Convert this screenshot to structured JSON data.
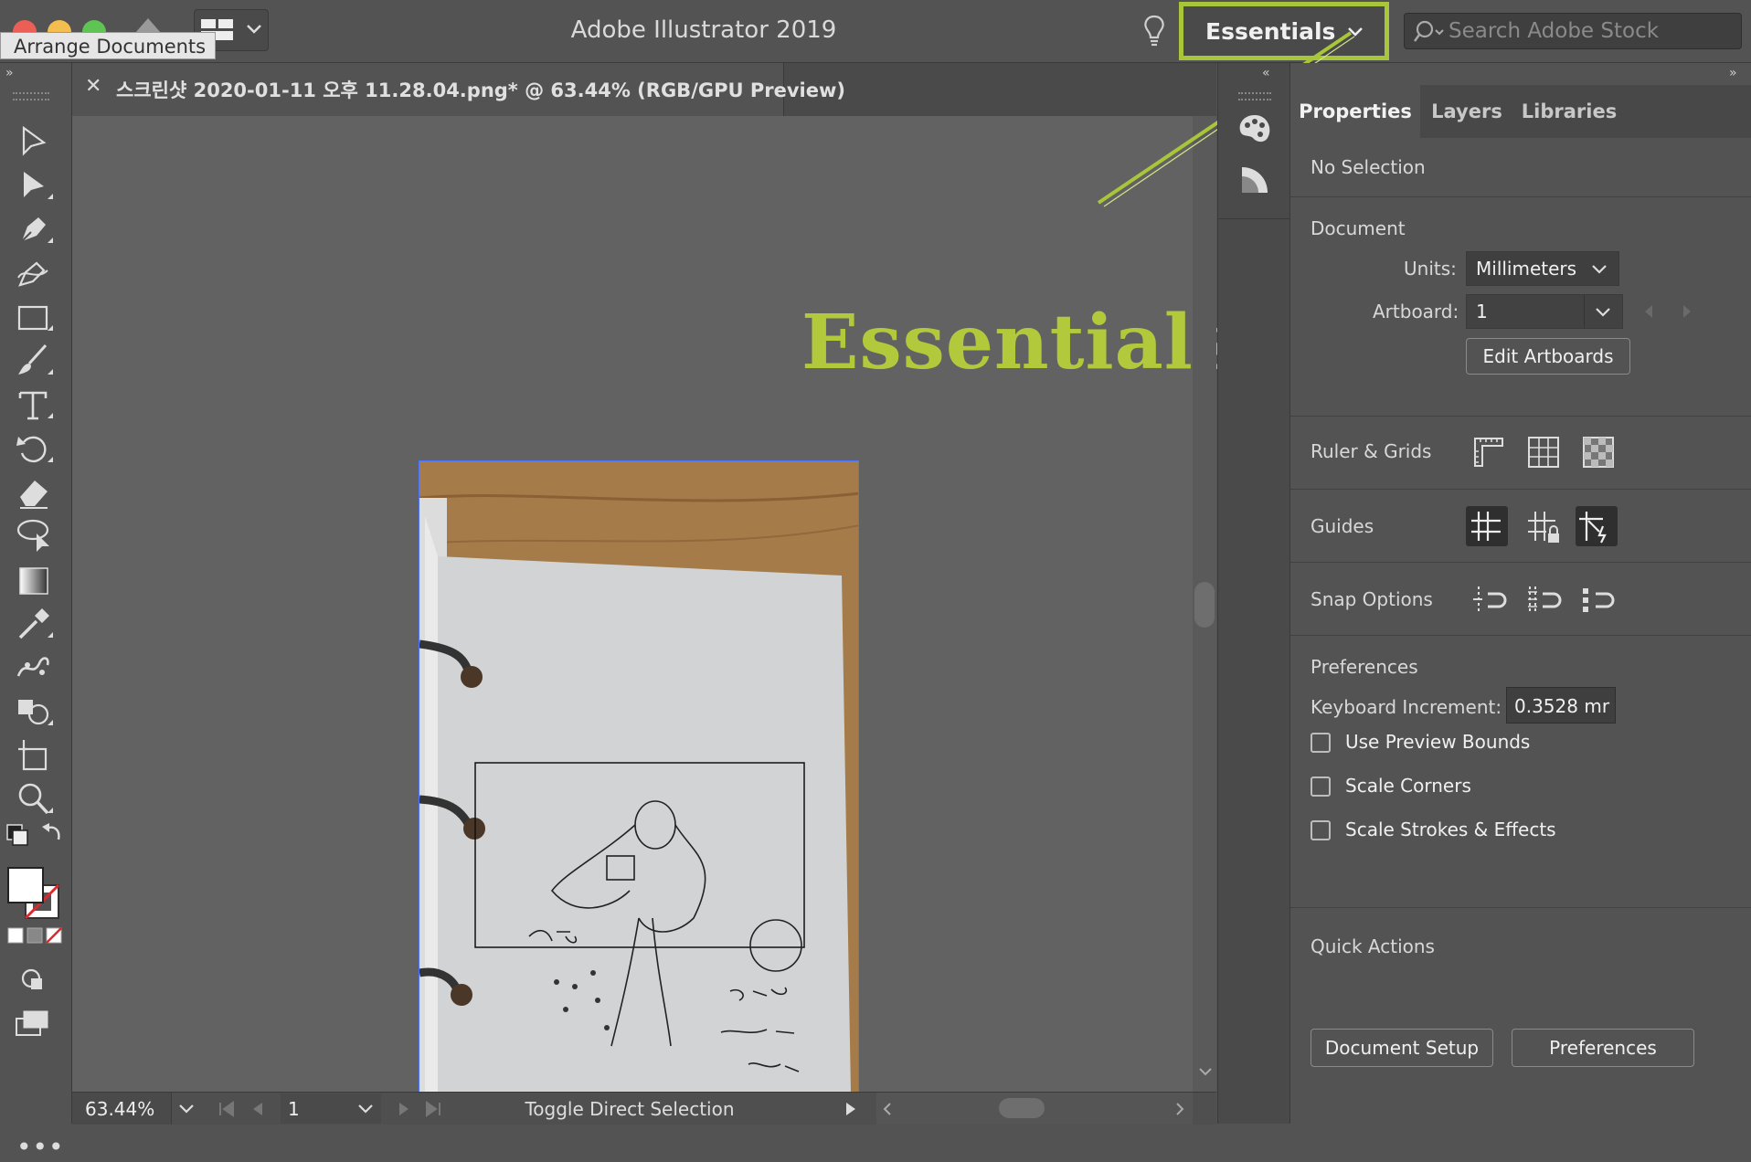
{
  "window": {
    "title": "Adobe Illustrator 2019"
  },
  "tooltip": {
    "arrange_documents": "Arrange Documents"
  },
  "workspace": {
    "label": "Essentials"
  },
  "search": {
    "placeholder": "Search Adobe Stock"
  },
  "document_tab": {
    "close_glyph": "✕",
    "title": "스크린샷 2020-01-11 오후 11.28.04.png* @ 63.44% (RGB/GPU Preview)"
  },
  "annotation": {
    "text": "Essentials",
    "color": "#b3c93c"
  },
  "panel": {
    "tabs": [
      "Properties",
      "Layers",
      "Libraries"
    ],
    "active_tab": "Properties",
    "selection": "No Selection",
    "document": {
      "heading": "Document",
      "units_label": "Units:",
      "units_value": "Millimeters",
      "artboard_label": "Artboard:",
      "artboard_value": "1",
      "edit_artboards": "Edit Artboards"
    },
    "ruler_grids": "Ruler & Grids",
    "guides": "Guides",
    "snap_options": "Snap Options",
    "preferences": {
      "heading": "Preferences",
      "keyboard_increment_label": "Keyboard Increment:",
      "keyboard_increment_value": "0.3528 mr",
      "checkboxes": [
        "Use Preview Bounds",
        "Scale Corners",
        "Scale Strokes & Effects"
      ]
    },
    "quick_actions": {
      "heading": "Quick Actions",
      "document_setup": "Document Setup",
      "preferences": "Preferences"
    }
  },
  "status": {
    "zoom": "63.44%",
    "artboard": "1",
    "tool": "Toggle Direct Selection"
  },
  "colors": {
    "accent_highlight": "#a9c63a",
    "ui_bg": "#535353",
    "canvas": "#626262"
  }
}
